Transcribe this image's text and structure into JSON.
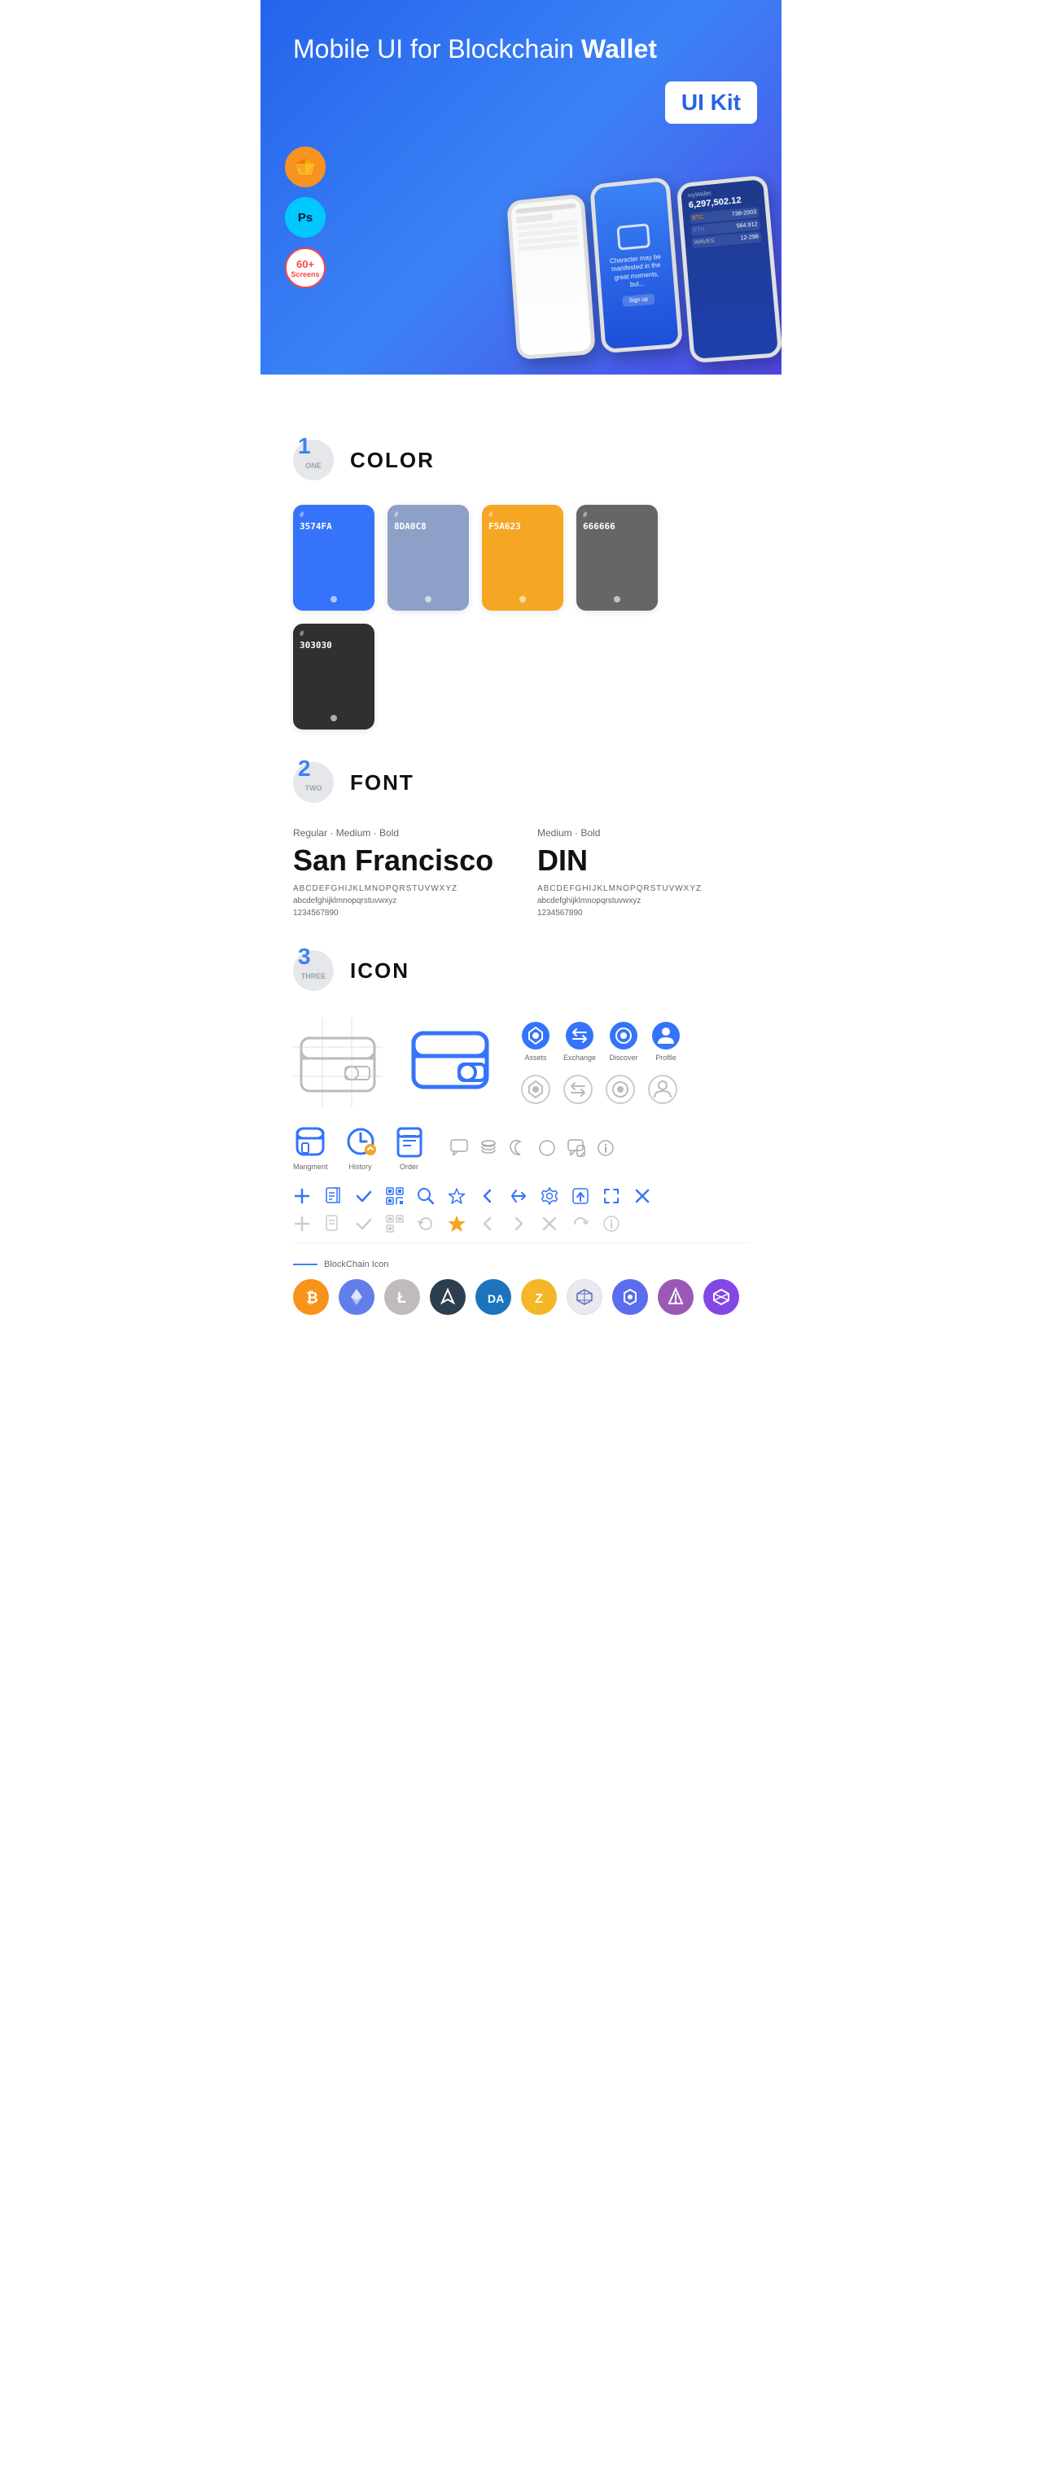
{
  "hero": {
    "title_part1": "Mobile UI for Blockchain ",
    "title_bold": "Wallet",
    "badge": "UI Kit",
    "badge_sketch": "S",
    "badge_ps": "Ps",
    "badge_screens": "60+",
    "badge_screens_label": "Screens"
  },
  "section1": {
    "number": "1",
    "number_label": "ONE",
    "title": "COLOR",
    "colors": [
      {
        "code": "#",
        "hex": "3574FA",
        "bg": "#3574FA"
      },
      {
        "code": "#",
        "hex": "8DA0C8",
        "bg": "#8DA0C8"
      },
      {
        "code": "#",
        "hex": "F5A623",
        "bg": "#F5A623"
      },
      {
        "code": "#",
        "hex": "666666",
        "bg": "#666666"
      },
      {
        "code": "#",
        "hex": "303030",
        "bg": "#303030"
      }
    ]
  },
  "section2": {
    "number": "2",
    "number_label": "TWO",
    "title": "FONT",
    "fonts": [
      {
        "weights": "Regular · Medium · Bold",
        "name": "San Francisco",
        "upper": "ABCDEFGHIJKLMNOPQRSTUVWXYZ",
        "lower": "abcdefghijklmnopqrstuvwxyz",
        "numbers": "1234567890"
      },
      {
        "weights": "Medium · Bold",
        "name": "DIN",
        "upper": "ABCDEFGHIJKLMNOPQRSTUVWXYZ",
        "lower": "abcdefghijklmnopqrstuvwxyz",
        "numbers": "1234567890"
      }
    ]
  },
  "section3": {
    "number": "3",
    "number_label": "THREE",
    "title": "ICON",
    "nav_icons": [
      {
        "label": "Assets",
        "colored": true
      },
      {
        "label": "Exchange",
        "colored": true
      },
      {
        "label": "Discover",
        "colored": true
      },
      {
        "label": "Profile",
        "colored": true
      }
    ],
    "app_icons": [
      {
        "label": "Mangment"
      },
      {
        "label": "History"
      },
      {
        "label": "Order"
      }
    ],
    "blockchain_label": "BlockChain Icon",
    "cryptos": [
      {
        "name": "Bitcoin",
        "color": "#f7931a",
        "symbol": "₿"
      },
      {
        "name": "Ethereum",
        "color": "#627eea",
        "symbol": "Ξ"
      },
      {
        "name": "Litecoin",
        "color": "#bfbbbb",
        "symbol": "Ł"
      },
      {
        "name": "Wings",
        "color": "#2c3e50",
        "symbol": "◆"
      },
      {
        "name": "Dash",
        "color": "#1c75bc",
        "symbol": "D"
      },
      {
        "name": "Zcash",
        "color": "#f4b728",
        "symbol": "Z"
      },
      {
        "name": "Grid",
        "color": "#5c6bc0",
        "symbol": "⬡"
      },
      {
        "name": "Status",
        "color": "#4a90e2",
        "symbol": "◈"
      },
      {
        "name": "Augur",
        "color": "#9b59b6",
        "symbol": "▲"
      },
      {
        "name": "Polygon",
        "color": "#8247e5",
        "symbol": "⬟"
      }
    ]
  }
}
